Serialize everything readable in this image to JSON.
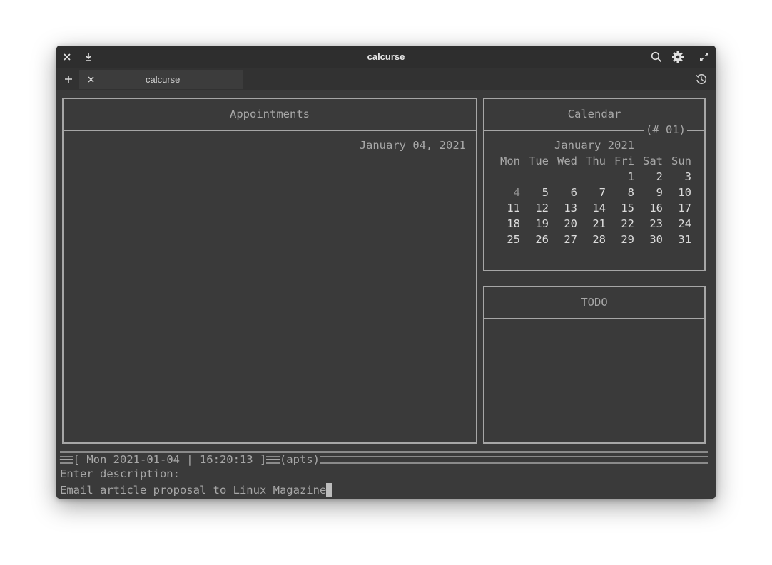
{
  "window": {
    "title": "calcurse"
  },
  "tabs": [
    {
      "label": "calcurse"
    }
  ],
  "appointments": {
    "title": "Appointments",
    "date": "January 04, 2021"
  },
  "calendar": {
    "title": "Calendar",
    "week": "(# 01)",
    "month_label": "January 2021",
    "weekdays": [
      "Mon",
      "Tue",
      "Wed",
      "Thu",
      "Fri",
      "Sat",
      "Sun"
    ],
    "weeks": [
      [
        "",
        "",
        "",
        "",
        "1",
        "2",
        "3"
      ],
      [
        "4",
        "5",
        "6",
        "7",
        "8",
        "9",
        "10"
      ],
      [
        "11",
        "12",
        "13",
        "14",
        "15",
        "16",
        "17"
      ],
      [
        "18",
        "19",
        "20",
        "21",
        "22",
        "23",
        "24"
      ],
      [
        "25",
        "26",
        "27",
        "28",
        "29",
        "30",
        "31"
      ]
    ],
    "selected_day": "4"
  },
  "todo": {
    "title": "TODO"
  },
  "status": {
    "datetime": "[ Mon 2021-01-04 | 16:20:13 ]",
    "mode": "(apts)"
  },
  "prompt": {
    "label": "Enter description:",
    "input": "Email article proposal to Linux Magazine"
  }
}
